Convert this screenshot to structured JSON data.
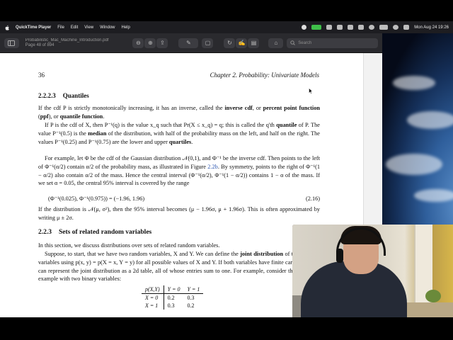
{
  "menubar": {
    "app_name": "QuickTime Player",
    "menus": [
      "File",
      "Edit",
      "View",
      "Window",
      "Help"
    ],
    "clock": "Mon Aug 24  19:26",
    "icons": [
      "apple-icon",
      "record-icon",
      "camera-icon",
      "dropbox-icon",
      "display-icon",
      "a-icon",
      "input-icon",
      "wifi-icon",
      "battery-icon",
      "search-icon",
      "control-center-icon"
    ]
  },
  "window": {
    "title_line1": "Probabilistic_Mac_Machine_Introduction.pdf",
    "title_line2": "Page 48 of 894",
    "search_placeholder": "Search"
  },
  "page": {
    "page_number": "36",
    "running_head": "Chapter 2.  Probability: Univariate Models",
    "section1": {
      "number": "2.2.2.3",
      "title": "Quantiles"
    },
    "p1": {
      "a": "If the cdf P is strictly monotonically increasing, it has an inverse, called the ",
      "b": "inverse cdf",
      "c": ", or ",
      "d": "percent point function",
      "e": " (",
      "f": "ppf",
      "g": "), or ",
      "h": "quantile function",
      "i": "."
    },
    "p2": {
      "a": "If P is the cdf of X, then P⁻¹(q) is the value x_q such that Pr(X ≤ x_q) = q; this is called the q'th ",
      "b": "quantile",
      "c": " of P. The value P⁻¹(0.5) is the ",
      "d": "median",
      "e": " of the distribution, with half of the probability mass on the left, and half on the right. The values P⁻¹(0.25) and P⁻¹(0.75) are the lower and upper ",
      "f": "quartiles",
      "g": "."
    },
    "p3": {
      "a": "For example, let Φ be the cdf of the Gaussian distribution 𝒩(0,1), and Φ⁻¹ be the inverse cdf. Then points to the left of Φ⁻¹(α/2) contain α/2 of the probability mass, as illustrated in Figure ",
      "link": "2.2b",
      "b": ". By symmetry, points to the right of Φ⁻¹(1 − α/2) also contain α/2 of the mass. Hence the central interval (Φ⁻¹(α/2), Φ⁻¹(1 − α/2)) contains 1 − α of the mass. If we set α = 0.05, the central 95% interval is covered by the range"
    },
    "eq": {
      "text": "(Φ⁻¹(0.025), Φ⁻¹(0.975)) = (−1.96, 1.96)",
      "number": "(2.16)"
    },
    "p4": "If the distribution is 𝒩(μ, σ²), then the 95% interval becomes (μ − 1.96σ, μ + 1.96σ). This is often approximated by writing μ ± 2σ.",
    "section2": {
      "number": "2.2.3",
      "title": "Sets of related random variables"
    },
    "p5": "In this section, we discuss distributions over sets of related random variables.",
    "p6": {
      "a": "Suppose, to start, that we have two random variables, X and Y. We can define the ",
      "b": "joint distribution",
      "c": " of two random variables using p(x, y) = p(X = x, Y = y) for all possible values of X and Y. If both variables have finite cardinality, we can represent the joint distribution as a 2d table, all of whose entries sum to one. For example, consider the following example with two binary variables:"
    },
    "table": {
      "header": [
        "p(X,Y)",
        "Y = 0",
        "Y = 1"
      ],
      "rows": [
        [
          "X = 0",
          "0.2",
          "0.3"
        ],
        [
          "X = 1",
          "0.3",
          "0.2"
        ]
      ]
    }
  },
  "colors": {
    "menubar": "#1d1d21",
    "toolbar": "#2a2a2e",
    "link": "#2a54b0",
    "page": "#ffffff"
  }
}
